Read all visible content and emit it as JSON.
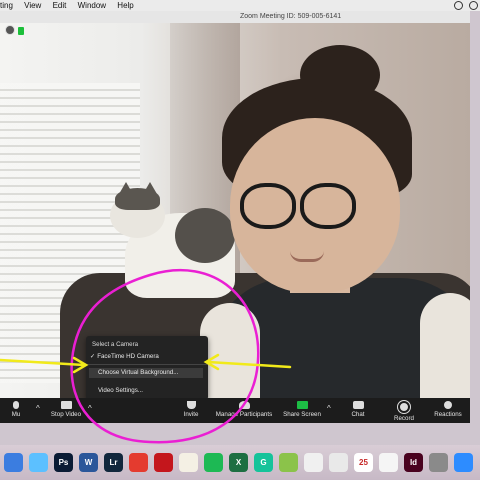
{
  "menubar": {
    "items": [
      "ting",
      "View",
      "Edit",
      "Window",
      "Help"
    ]
  },
  "window": {
    "title": "Zoom Meeting ID: 509-005-6141"
  },
  "camera_menu": {
    "header": "Select a Camera",
    "camera_option": "FaceTime HD Camera",
    "camera_check": "✓",
    "virtual_background": "Choose Virtual Background...",
    "video_settings": "Video Settings..."
  },
  "toolbar": {
    "mute": "Mu",
    "stop_video": "Stop Video",
    "invite": "Invite",
    "manage_participants": "Manage Participants",
    "share_screen": "Share Screen",
    "chat": "Chat",
    "record": "Record",
    "reactions": "Reactions",
    "chevron": "^"
  },
  "dock": {
    "apps": [
      {
        "icon": "finder-icon",
        "label": "",
        "color": "#3b7de0"
      },
      {
        "icon": "messages-icon",
        "label": "",
        "color": "#5cc0ff"
      },
      {
        "icon": "photoshop-icon",
        "label": "Ps",
        "color": "#0a1b34"
      },
      {
        "icon": "word-icon",
        "label": "W",
        "color": "#2b579a"
      },
      {
        "icon": "lightroom-icon",
        "label": "Lr",
        "color": "#11273c"
      },
      {
        "icon": "pdf-icon",
        "label": "",
        "color": "#e43b2f"
      },
      {
        "icon": "acrobat-icon",
        "label": "",
        "color": "#c4161c"
      },
      {
        "icon": "notes-icon",
        "label": "",
        "color": "#f4f0e4"
      },
      {
        "icon": "spotify-icon",
        "label": "",
        "color": "#1db954"
      },
      {
        "icon": "excel-icon",
        "label": "X",
        "color": "#1d6f42"
      },
      {
        "icon": "grammarly-icon",
        "label": "G",
        "color": "#15c39a"
      },
      {
        "icon": "flower-icon",
        "label": "",
        "color": "#8bc34a"
      },
      {
        "icon": "photos-icon",
        "label": "",
        "color": "#f0f0f0"
      },
      {
        "icon": "chrome-icon",
        "label": "",
        "color": "#e9e9e9"
      },
      {
        "icon": "calendar-icon",
        "label": "25",
        "color": "#ffffff"
      },
      {
        "icon": "reminders-icon",
        "label": "",
        "color": "#f5f5f5"
      },
      {
        "icon": "indesign-icon",
        "label": "Id",
        "color": "#49021f"
      },
      {
        "icon": "system-preferences-icon",
        "label": "",
        "color": "#8a8a8a"
      },
      {
        "icon": "zoom-icon",
        "label": "",
        "color": "#2d8cff"
      }
    ]
  },
  "annotation": {
    "circle_color": "#ea1fd3",
    "arrow_color": "#f1ea1a"
  }
}
